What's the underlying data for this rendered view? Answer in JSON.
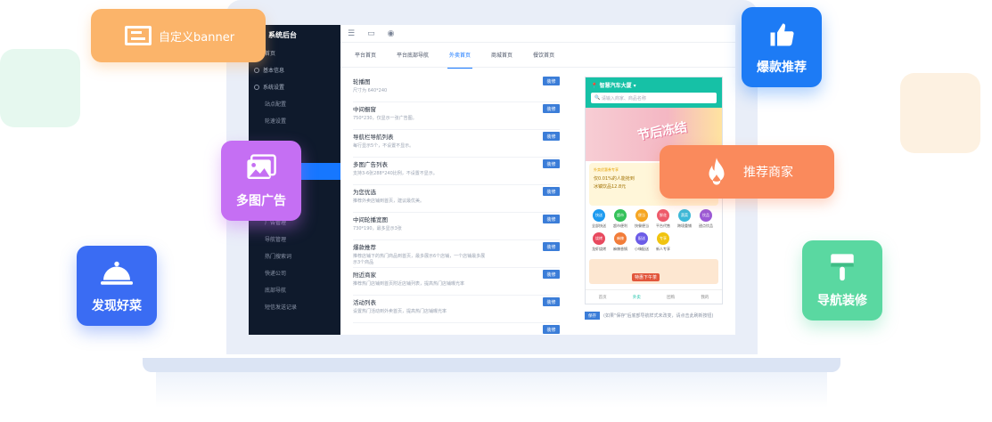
{
  "admin": {
    "title": "系统后台",
    "sidebar": [
      {
        "label": "首页",
        "kind": "top"
      },
      {
        "label": "基本信息",
        "kind": "parent"
      },
      {
        "label": "系统设置",
        "kind": "parent"
      },
      {
        "label": "站点配置",
        "kind": "sub"
      },
      {
        "label": "轮速设置",
        "kind": "sub"
      },
      {
        "label": "",
        "kind": "sub"
      },
      {
        "label": "",
        "kind": "sub"
      },
      {
        "label": "",
        "kind": "active"
      },
      {
        "label": "",
        "kind": "sub"
      },
      {
        "label": "",
        "kind": "sub"
      },
      {
        "label": "广告管理",
        "kind": "sub"
      },
      {
        "label": "导航管理",
        "kind": "sub"
      },
      {
        "label": "热门搜索词",
        "kind": "sub"
      },
      {
        "label": "快递公司",
        "kind": "sub"
      },
      {
        "label": "底部导航",
        "kind": "sub"
      },
      {
        "label": "短信发送记录",
        "kind": "sub"
      }
    ],
    "tabs": [
      "平台首页",
      "平台底部导航",
      "外卖首页",
      "商城首页",
      "餐饮首页"
    ],
    "active_tab": 2,
    "config_rows": [
      {
        "title": "轮播图",
        "desc": "尺寸为 640*240",
        "btn": "装修"
      },
      {
        "title": "中间橱窗",
        "desc": "750*230，仅显示一张广告图。",
        "btn": "装修"
      },
      {
        "title": "导航栏导航列表",
        "desc": "每行显示5个，不设置不显示。",
        "btn": "装修"
      },
      {
        "title": "多图广告列表",
        "desc": "支持3-6张288*240比例，不设置不显示。",
        "btn": "装修"
      },
      {
        "title": "为您优选",
        "desc": "推荐外卖店铺到首页，建议最优美。",
        "btn": "装修"
      },
      {
        "title": "中间轮播宽图",
        "desc": "730*190，最多显示3张",
        "btn": "装修"
      },
      {
        "title": "爆款推荐",
        "desc": "推荐店铺下的热门商品到首页，最多展示6个店铺，一个店铺最多展示3个商品",
        "btn": "装修"
      },
      {
        "title": "附近商家",
        "desc": "推荐热门店铺到首页附近店铺列表，提高热门店铺曝光率",
        "btn": "装修"
      },
      {
        "title": "活动列表",
        "desc": "设置热门活动到外卖首页，提高热门店铺曝光率",
        "btn": "装修"
      },
      {
        "title": "",
        "desc": "",
        "btn": "装修"
      }
    ],
    "phone": {
      "location": "智慧汽车大厦",
      "search_placeholder": "请输入商家、商品名称",
      "banner_text": "节后冻结",
      "coupon_tag": "外卖优惠券专享",
      "coupon_line1": "仅0.01%的人能抢到",
      "coupon_line2": "冰镇饮品12.8元",
      "icons": [
        {
          "label": "全部快送",
          "color": "#1d9bf0",
          "tag": "快送"
        },
        {
          "label": "超市便利",
          "color": "#34c25a",
          "tag": "超市"
        },
        {
          "label": "快餐便当",
          "color": "#f6a623",
          "tag": "便当"
        },
        {
          "label": "平台代售",
          "color": "#ee5b6b",
          "tag": "鲜花"
        },
        {
          "label": "跨境重铺",
          "color": "#3bb9d9",
          "tag": "蔬菜"
        },
        {
          "label": "甜点饮品",
          "color": "#9b59d6",
          "tag": "饮品"
        },
        {
          "label": "龙虾烧烤",
          "color": "#e84a5f",
          "tag": "烧烤"
        },
        {
          "label": "麻辣香锅",
          "color": "#f27d3a",
          "tag": "麻辣"
        },
        {
          "label": "小嗨配送",
          "color": "#6c5ce7",
          "tag": "配送"
        },
        {
          "label": "新人专享",
          "color": "#f1c40f",
          "tag": "专享"
        }
      ],
      "promo": "特惠下午茶",
      "nav": [
        "首页",
        "外卖",
        "团购",
        "我的"
      ],
      "nav_active": 1,
      "note_btn": "保存",
      "note_text": "(如果\"保存\"后底部导航样式未改变，请点击此刷新按钮)"
    }
  },
  "cards": {
    "banner": "自定义banner",
    "hot": "爆款推荐",
    "merchant": "推荐商家",
    "multi": "多图广告",
    "dish": "发现好菜",
    "nav": "导航装修"
  }
}
